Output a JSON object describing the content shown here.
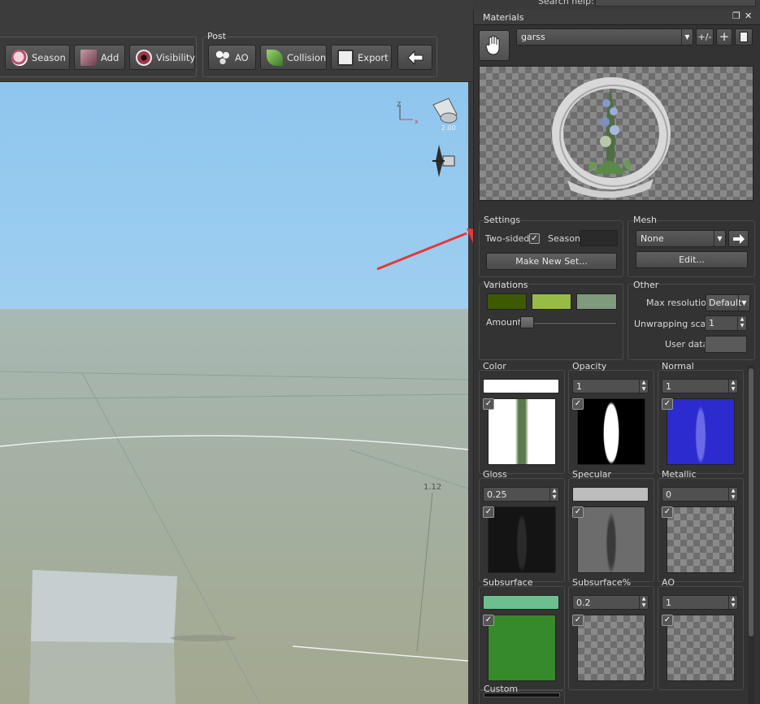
{
  "search": {
    "label": "Search help:"
  },
  "toolbar": {
    "post_label": "Post",
    "buttons": [
      {
        "label": "Season"
      },
      {
        "label": "Add"
      },
      {
        "label": "Visibility"
      },
      {
        "label": "AO"
      },
      {
        "label": "Collision"
      },
      {
        "label": "Export"
      }
    ]
  },
  "viewport": {
    "camera_value": "2.00",
    "dimension_label": "1.12",
    "axis_z": "Z",
    "axis_x": "x"
  },
  "panel": {
    "title": "Materials",
    "restore_icon": "restore-icon",
    "close_icon": "close-icon",
    "material_name": "garss",
    "plusminus_label": "+/-",
    "settings": {
      "title": "Settings",
      "two_sided_label": "Two-sided",
      "two_sided_checked": true,
      "season_label": "Season",
      "make_new_set_label": "Make New Set..."
    },
    "mesh": {
      "title": "Mesh",
      "value": "None",
      "edit_label": "Edit..."
    },
    "variations": {
      "title": "Variations",
      "colors": [
        "#3d5a00",
        "#98bb46",
        "#7f9a7c"
      ],
      "amount_label": "Amount"
    },
    "other": {
      "title": "Other",
      "max_resolution_label": "Max resolution",
      "max_resolution_value": "Default",
      "unwrapping_scale_label": "Unwrapping scale",
      "unwrapping_scale_value": "1",
      "user_data_label": "User data"
    },
    "maps": [
      {
        "title": "Color",
        "value": "",
        "swatch": "#ffffff"
      },
      {
        "title": "Opacity",
        "value": "1"
      },
      {
        "title": "Normal",
        "value": "1"
      },
      {
        "title": "Gloss",
        "value": "0.25"
      },
      {
        "title": "Specular",
        "value": "",
        "swatch": "#bdbdbd"
      },
      {
        "title": "Metallic",
        "value": "0"
      },
      {
        "title": "Subsurface",
        "value": "",
        "swatch": "#6cc08f"
      },
      {
        "title": "Subsurface%",
        "value": "0.2"
      },
      {
        "title": "AO",
        "value": "1"
      }
    ],
    "custom_title": "Custom"
  }
}
